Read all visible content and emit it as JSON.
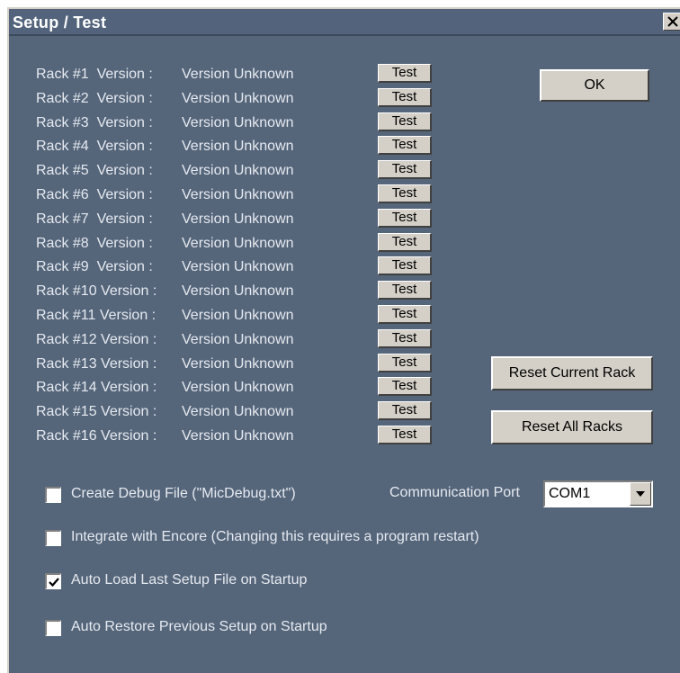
{
  "window": {
    "title": "Setup / Test"
  },
  "racks": [
    {
      "name": "Rack #1  Version :",
      "version": "Version Unknown",
      "test_label": "Test"
    },
    {
      "name": "Rack #2  Version :",
      "version": "Version Unknown",
      "test_label": "Test"
    },
    {
      "name": "Rack #3  Version :",
      "version": "Version Unknown",
      "test_label": "Test"
    },
    {
      "name": "Rack #4  Version :",
      "version": "Version Unknown",
      "test_label": "Test"
    },
    {
      "name": "Rack #5  Version :",
      "version": "Version Unknown",
      "test_label": "Test"
    },
    {
      "name": "Rack #6  Version :",
      "version": "Version Unknown",
      "test_label": "Test"
    },
    {
      "name": "Rack #7  Version :",
      "version": "Version Unknown",
      "test_label": "Test"
    },
    {
      "name": "Rack #8  Version :",
      "version": "Version Unknown",
      "test_label": "Test"
    },
    {
      "name": "Rack #9  Version :",
      "version": "Version Unknown",
      "test_label": "Test"
    },
    {
      "name": "Rack #10 Version :",
      "version": "Version Unknown",
      "test_label": "Test"
    },
    {
      "name": "Rack #11 Version :",
      "version": "Version Unknown",
      "test_label": "Test"
    },
    {
      "name": "Rack #12 Version :",
      "version": "Version Unknown",
      "test_label": "Test"
    },
    {
      "name": "Rack #13 Version :",
      "version": "Version Unknown",
      "test_label": "Test"
    },
    {
      "name": "Rack #14 Version :",
      "version": "Version Unknown",
      "test_label": "Test"
    },
    {
      "name": "Rack #15 Version :",
      "version": "Version Unknown",
      "test_label": "Test"
    },
    {
      "name": "Rack #16 Version :",
      "version": "Version Unknown",
      "test_label": "Test"
    }
  ],
  "buttons": {
    "ok": "OK",
    "reset_current": "Reset Current Rack",
    "reset_all": "Reset All Racks"
  },
  "options": [
    {
      "label": "Create Debug File (\"MicDebug.txt\")",
      "checked": false
    },
    {
      "label": "Integrate with Encore (Changing this requires a program restart)",
      "checked": false
    },
    {
      "label": "Auto Load Last Setup File on Startup",
      "checked": true
    },
    {
      "label": "Auto Restore Previous Setup on Startup",
      "checked": false
    }
  ],
  "communication": {
    "label": "Communication Port",
    "selected": "COM1"
  },
  "colors": {
    "dialog_background": "#55657a",
    "button_face": "#d4d0c8",
    "text": "#e6eaf0"
  },
  "icons": {
    "close": "close-icon",
    "dropdown": "chevron-down-icon",
    "check": "checkmark-icon"
  }
}
